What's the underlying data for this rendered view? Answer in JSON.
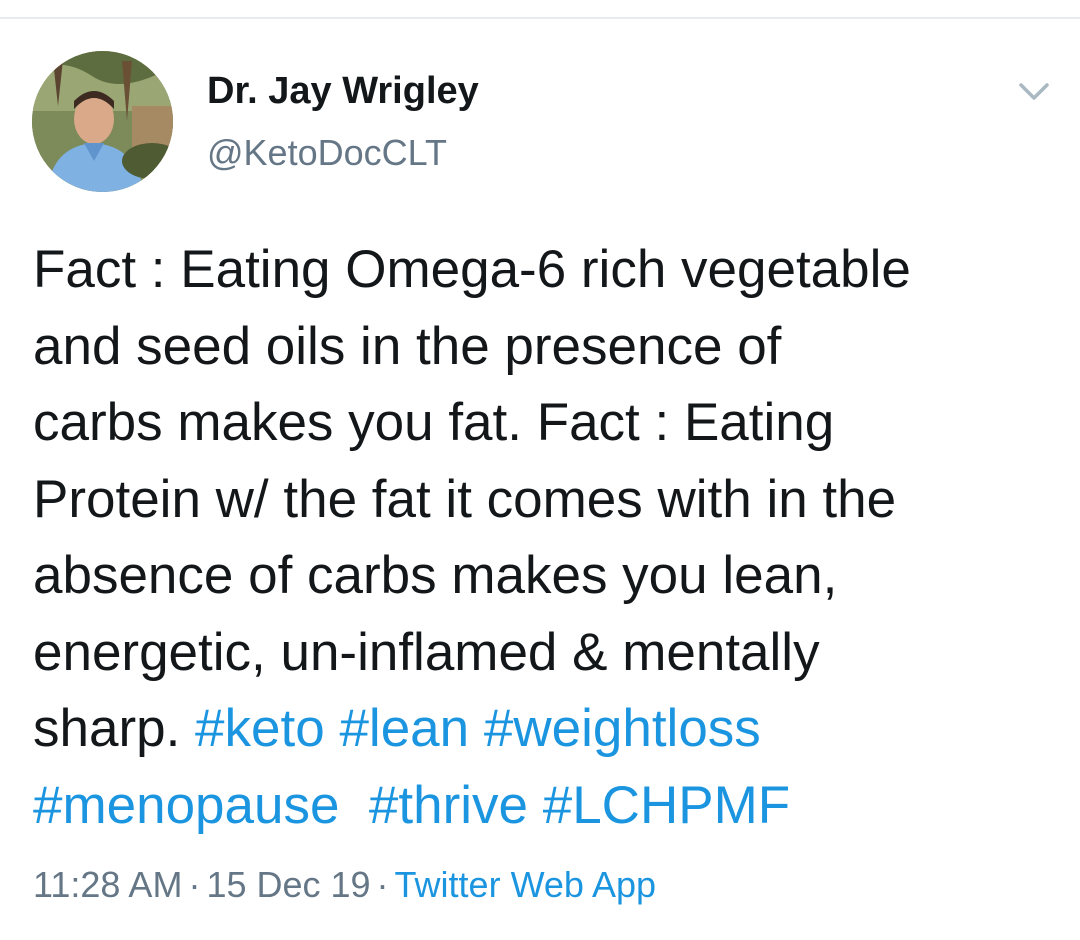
{
  "author": {
    "display_name": "Dr. Jay Wrigley",
    "handle": "@KetoDocCLT"
  },
  "tweet": {
    "lines": [
      "Fact : Eating Omega-6 rich vegetable",
      "and seed oils in the presence of",
      "carbs makes you fat. Fact : Eating",
      "Protein w/ the fat it comes with in the",
      "absence of carbs makes you lean,",
      "energetic, un-inflamed & mentally",
      "sharp."
    ],
    "hashtags": [
      "#keto",
      "#lean",
      "#weightloss",
      "#menopause",
      "#thrive",
      "#LCHPMF"
    ]
  },
  "meta": {
    "time": "11:28 AM",
    "date": "15 Dec 19",
    "separator": "·",
    "source": "Twitter Web App"
  },
  "icons": {
    "menu": "chevron-down-icon",
    "avatar": "profile-photo"
  },
  "colors": {
    "link": "#1b95e0",
    "secondary_text": "#657786",
    "primary_text": "#14171a",
    "divider": "#e6ecf0"
  }
}
